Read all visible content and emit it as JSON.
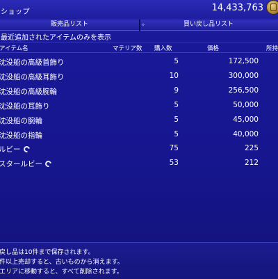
{
  "header": {
    "title": "ショップ",
    "gil": "14,433,763"
  },
  "tabs": [
    {
      "label": "販売品リスト"
    },
    {
      "label": "買い戻し品リスト"
    }
  ],
  "info": "最近追加されたアイテムのみを表示",
  "columns": {
    "name": "アイテム名",
    "materia": "マテリア数",
    "purchase": "購入数",
    "price": "価格",
    "owned": "所持"
  },
  "rows": [
    {
      "name": "沈没船の高級首飾り",
      "qty": "5",
      "price": "172,500",
      "materia": false
    },
    {
      "name": "沈没船の高級耳飾り",
      "qty": "10",
      "price": "300,000",
      "materia": false
    },
    {
      "name": "沈没船の高級腕輪",
      "qty": "9",
      "price": "256,500",
      "materia": false
    },
    {
      "name": "沈没船の耳飾り",
      "qty": "5",
      "price": "50,000",
      "materia": false
    },
    {
      "name": "沈没船の腕輪",
      "qty": "5",
      "price": "45,000",
      "materia": false
    },
    {
      "name": "沈没船の指輪",
      "qty": "5",
      "price": "40,000",
      "materia": false
    },
    {
      "name": "ルビー",
      "qty": "75",
      "price": "225",
      "materia": true
    },
    {
      "name": "スタールビー",
      "qty": "53",
      "price": "212",
      "materia": true
    }
  ],
  "footer": [
    "戻し品は10件まで保存されます。",
    "件以上売却すると、古いものから消えます。",
    "エリアに移動すると、すべて削除されます。"
  ],
  "icons": {
    "gil": "gil-coin-icon",
    "tab_marker": "tab-marker-icon",
    "hq": "collectable-swirl-icon"
  }
}
